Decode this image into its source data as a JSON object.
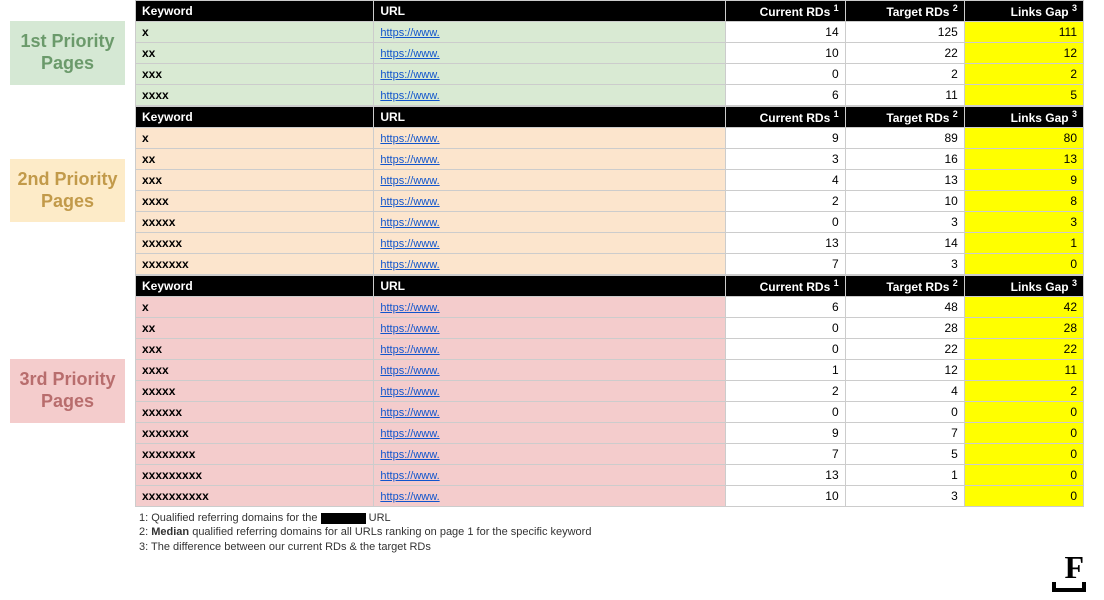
{
  "headers": {
    "keyword": "Keyword",
    "url": "URL",
    "current": "Current RDs",
    "target": "Target RDs",
    "gap": "Links Gap",
    "sup1": "1",
    "sup2": "2",
    "sup3": "3"
  },
  "sections": [
    {
      "label": "1st Priority Pages",
      "label_class": "label-1",
      "row_class": "sec1",
      "rows": [
        {
          "keyword": "x",
          "url": "https://www.",
          "current": 14,
          "target": 125,
          "gap": 111
        },
        {
          "keyword": "xx",
          "url": "https://www.",
          "current": 10,
          "target": 22,
          "gap": 12
        },
        {
          "keyword": "xxx",
          "url": "https://www.",
          "current": 0,
          "target": 2,
          "gap": 2
        },
        {
          "keyword": "xxxx",
          "url": "https://www.",
          "current": 6,
          "target": 11,
          "gap": 5
        }
      ]
    },
    {
      "label": "2nd Priority Pages",
      "label_class": "label-2",
      "row_class": "sec2",
      "rows": [
        {
          "keyword": "x",
          "url": "https://www.",
          "current": 9,
          "target": 89,
          "gap": 80
        },
        {
          "keyword": "xx",
          "url": "https://www.",
          "current": 3,
          "target": 16,
          "gap": 13
        },
        {
          "keyword": "xxx",
          "url": "https://www.",
          "current": 4,
          "target": 13,
          "gap": 9
        },
        {
          "keyword": "xxxx",
          "url": "https://www.",
          "current": 2,
          "target": 10,
          "gap": 8
        },
        {
          "keyword": "xxxxx",
          "url": "https://www.",
          "current": 0,
          "target": 3,
          "gap": 3
        },
        {
          "keyword": "xxxxxx",
          "url": "https://www.",
          "current": 13,
          "target": 14,
          "gap": 1
        },
        {
          "keyword": "xxxxxxx",
          "url": "https://www.",
          "current": 7,
          "target": 3,
          "gap": 0
        }
      ]
    },
    {
      "label": "3rd Priority Pages",
      "label_class": "label-3",
      "row_class": "sec3",
      "rows": [
        {
          "keyword": "x",
          "url": "https://www.",
          "current": 6,
          "target": 48,
          "gap": 42
        },
        {
          "keyword": "xx",
          "url": "https://www.",
          "current": 0,
          "target": 28,
          "gap": 28
        },
        {
          "keyword": "xxx",
          "url": "https://www.",
          "current": 0,
          "target": 22,
          "gap": 22
        },
        {
          "keyword": "xxxx",
          "url": "https://www.",
          "current": 1,
          "target": 12,
          "gap": 11
        },
        {
          "keyword": "xxxxx",
          "url": "https://www.",
          "current": 2,
          "target": 4,
          "gap": 2
        },
        {
          "keyword": "xxxxxx",
          "url": "https://www.",
          "current": 0,
          "target": 0,
          "gap": 0
        },
        {
          "keyword": "xxxxxxx",
          "url": "https://www.",
          "current": 9,
          "target": 7,
          "gap": 0
        },
        {
          "keyword": "xxxxxxxx",
          "url": "https://www.",
          "current": 7,
          "target": 5,
          "gap": 0
        },
        {
          "keyword": "xxxxxxxxx",
          "url": "https://www.",
          "current": 13,
          "target": 1,
          "gap": 0
        },
        {
          "keyword": "xxxxxxxxxx",
          "url": "https://www.",
          "current": 10,
          "target": 3,
          "gap": 0
        }
      ]
    }
  ],
  "footnotes": {
    "f1_pre": "1: Qualified referring domains for the ",
    "f1_post": " URL",
    "f2_pre": "2: ",
    "f2_bold": "Median",
    "f2_post": " qualified referring domains for all URLs ranking on page 1 for the specific keyword",
    "f3": "3: The difference between our current RDs & the target RDs"
  },
  "logo_text": "F"
}
